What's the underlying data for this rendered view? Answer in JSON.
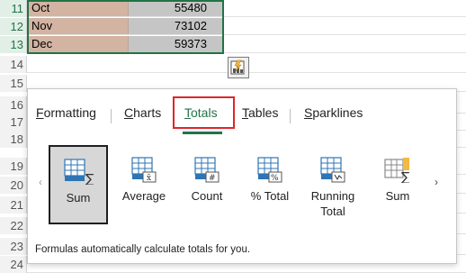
{
  "sheet": {
    "rows": [
      {
        "num": "11",
        "a": "Oct",
        "b": "55480",
        "selected": true
      },
      {
        "num": "12",
        "a": "Nov",
        "b": "73102",
        "selected": true
      },
      {
        "num": "13",
        "a": "Dec",
        "b": "59373",
        "selected": true
      },
      {
        "num": "14",
        "a": "",
        "b": "",
        "selected": false
      },
      {
        "num": "15",
        "a": "",
        "b": "",
        "selected": false
      },
      {
        "num": "16",
        "a": "",
        "b": "",
        "selected": false
      },
      {
        "num": "17",
        "a": "",
        "b": "",
        "selected": false
      },
      {
        "num": "18",
        "a": "",
        "b": "",
        "selected": false
      },
      {
        "num": "19",
        "a": "",
        "b": "",
        "selected": false
      },
      {
        "num": "20",
        "a": "",
        "b": "",
        "selected": false
      },
      {
        "num": "21",
        "a": "",
        "b": "",
        "selected": false
      },
      {
        "num": "22",
        "a": "",
        "b": "",
        "selected": false
      },
      {
        "num": "23",
        "a": "",
        "b": "",
        "selected": false
      },
      {
        "num": "24",
        "a": "",
        "b": "",
        "selected": false
      }
    ]
  },
  "quick_analysis": {
    "tabs": [
      {
        "prefix": "",
        "key": "F",
        "rest": "ormatting",
        "active": false
      },
      {
        "prefix": "",
        "key": "C",
        "rest": "harts",
        "active": false
      },
      {
        "prefix": "",
        "key": "T",
        "rest": "otals",
        "active": true
      },
      {
        "prefix": "",
        "key": "T",
        "rest": "ables",
        "active": false
      },
      {
        "prefix": "",
        "key": "S",
        "rest": "parklines",
        "active": false
      }
    ],
    "items": [
      {
        "label": "Sum",
        "icon": "sum-row-icon",
        "active": true
      },
      {
        "label": "Average",
        "icon": "average-icon",
        "active": false
      },
      {
        "label": "Count",
        "icon": "count-icon",
        "active": false
      },
      {
        "label": "% Total",
        "icon": "percent-total-icon",
        "active": false
      },
      {
        "label": "Running Total",
        "icon": "running-total-icon",
        "active": false
      },
      {
        "label": "Sum",
        "icon": "sum-column-icon",
        "active": false
      }
    ],
    "prev_glyph": "‹",
    "next_glyph": "›",
    "hint": "Formulas automatically calculate totals for you."
  },
  "colors": {
    "accent_green": "#217346",
    "highlight_red": "#e0252b",
    "icon_blue": "#2e75b6",
    "icon_orange": "#f4b942"
  }
}
